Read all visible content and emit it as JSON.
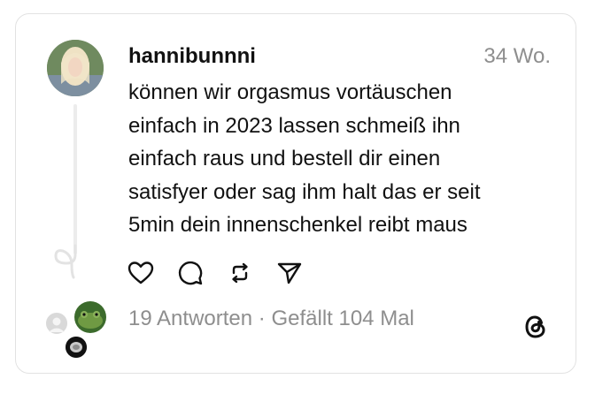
{
  "post": {
    "username": "hannibunnni",
    "timestamp": "34 Wo.",
    "text_lines": [
      "können wir orgasmus vortäuschen",
      "einfach in 2023 lassen schmeiß ihn",
      "einfach raus und bestell dir einen",
      "satisfyer oder sag ihm halt das er seit",
      "5min dein innenschenkel reibt maus"
    ]
  },
  "actions": [
    {
      "name": "like",
      "icon": "heart-icon"
    },
    {
      "name": "reply",
      "icon": "comment-icon"
    },
    {
      "name": "repost",
      "icon": "repost-icon"
    },
    {
      "name": "share",
      "icon": "send-icon"
    }
  ],
  "footer": {
    "replies": "19 Antworten",
    "separator": "·",
    "likes": "Gefällt 104 Mal"
  },
  "icons": {
    "brand": "threads-logo-icon"
  },
  "colors": {
    "text": "#111111",
    "muted": "#8e8e8e",
    "border": "#e2e2e2"
  }
}
